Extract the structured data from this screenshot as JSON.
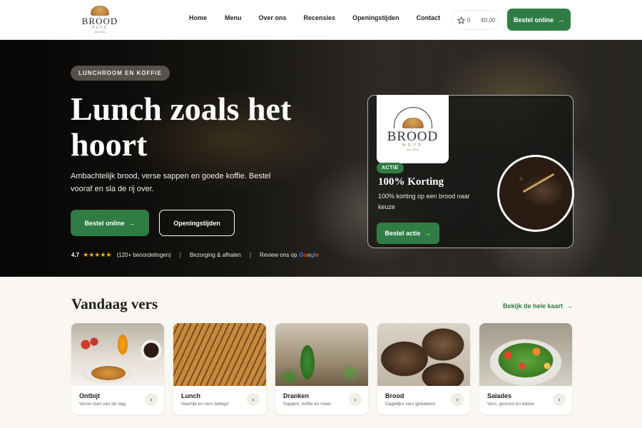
{
  "nav": {
    "logo": {
      "wordmark": "BROOD",
      "sub": "HUYS",
      "est": "est. 2021"
    },
    "links": [
      "Home",
      "Menu",
      "Over ons",
      "Recensies",
      "Openingstijden",
      "Contact"
    ],
    "favorites_count": "0",
    "cart_total": "€0,00",
    "cta_label": "Bestel online"
  },
  "hero": {
    "tag": "LUNCHROOM EN KOFFIE",
    "title": "Lunch zoals het hoort",
    "lead": "Ambachtelijk brood, verse sappen en goede koffie. Bestel vooraf en sla de rij over.",
    "primary_button": "Bestel online",
    "secondary_button": "Openingstijden",
    "rating": {
      "score": "4.7",
      "stars": "★★★★★",
      "count": "(120+ beoordelingen)",
      "delivery": "Bezorging & afhalen",
      "review": "Review ons op"
    }
  },
  "promo": {
    "logo": {
      "wordmark": "BROOD",
      "sub": "HUYS",
      "est": "est. 2021"
    },
    "badge": "ACTIE",
    "title": "100% Korting",
    "description": "100% korting op een brood naar keuze",
    "button": "Bestel actie"
  },
  "section": {
    "title": "Vandaag vers",
    "link": "Bekijk de hele kaart"
  },
  "categories": [
    {
      "title": "Ontbijt",
      "subtitle": "Verse start van de dag"
    },
    {
      "title": "Lunch",
      "subtitle": "Heerlijk en vers belegd"
    },
    {
      "title": "Dranken",
      "subtitle": "Sappen, koffie en meer"
    },
    {
      "title": "Brood",
      "subtitle": "Dagelijks vers gebakken"
    },
    {
      "title": "Salades",
      "subtitle": "Vers, gezond en lekker"
    }
  ],
  "colors": {
    "accent": "#2f7d45",
    "background": "#faf7f2"
  },
  "icons": {
    "favorites": "star-icon",
    "arrow": "arrow-right-icon",
    "chevron": "chevron-right-icon"
  }
}
